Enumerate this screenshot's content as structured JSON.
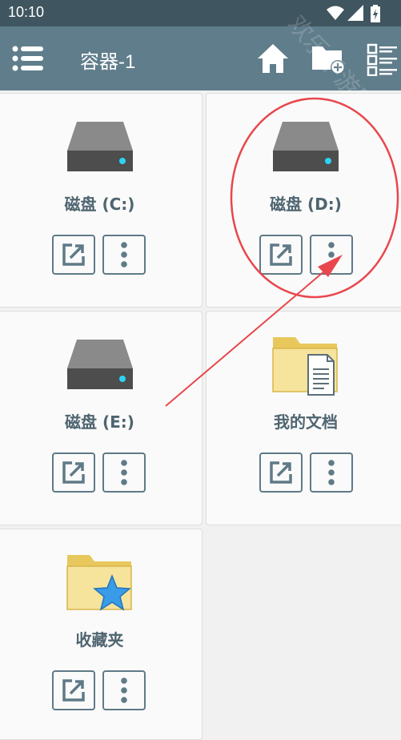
{
  "status": {
    "time": "10:10"
  },
  "appbar": {
    "title": "容器-1"
  },
  "watermark": "欢乐手游网",
  "items": [
    {
      "label": "磁盘 (C:)",
      "icon": "hard-drive-icon"
    },
    {
      "label": "磁盘 (D:)",
      "icon": "hard-drive-icon"
    },
    {
      "label": "磁盘 (E:)",
      "icon": "hard-drive-icon"
    },
    {
      "label": "我的文档",
      "icon": "documents-folder-icon"
    },
    {
      "label": "收藏夹",
      "icon": "favorites-folder-icon"
    }
  ],
  "colors": {
    "statusbar": "#3f555f",
    "appbar": "#607d8b",
    "annotation": "#e8474c"
  }
}
